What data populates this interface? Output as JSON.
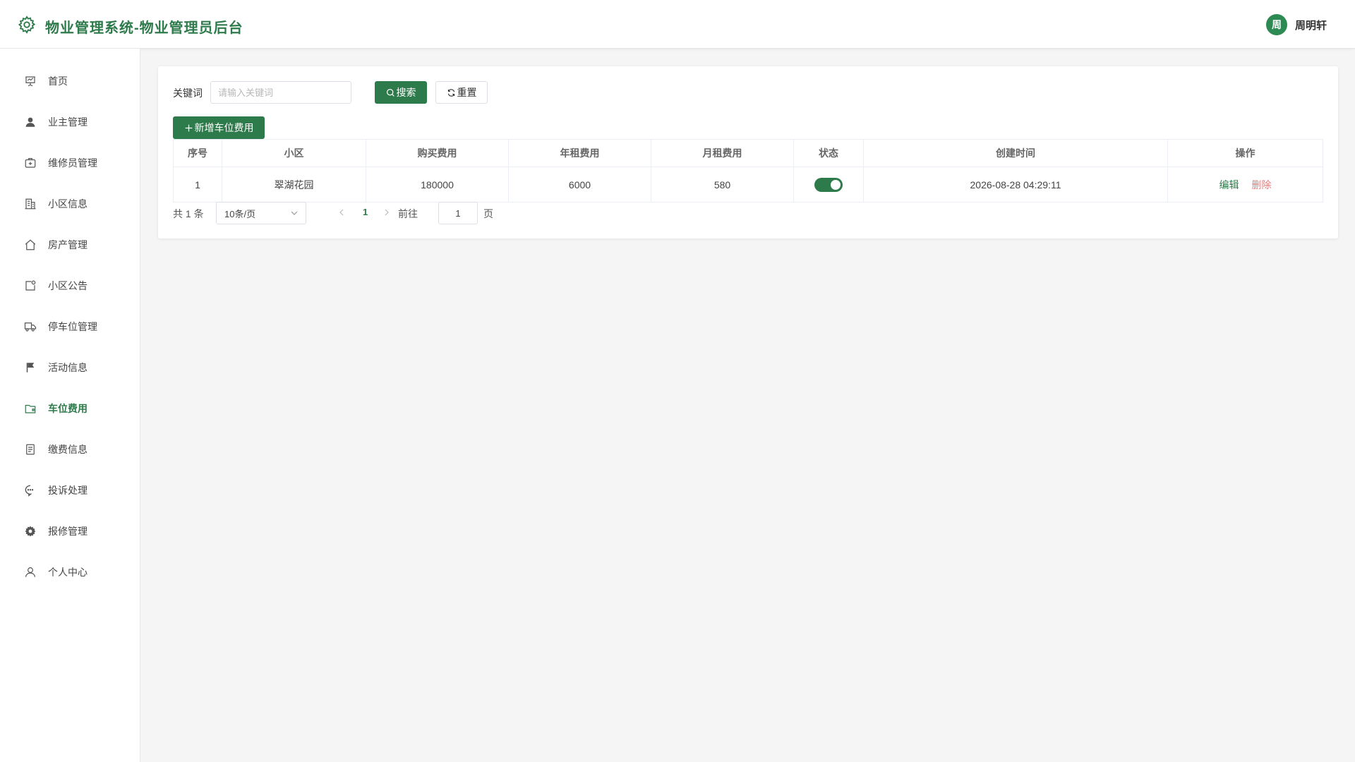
{
  "header": {
    "title": "物业管理系统-物业管理员后台",
    "user_avatar_text": "周",
    "user_name": "周明轩"
  },
  "sidebar": {
    "items": [
      {
        "label": "首页",
        "icon": "presentation-icon"
      },
      {
        "label": "业主管理",
        "icon": "user-icon"
      },
      {
        "label": "维修员管理",
        "icon": "first-aid-kit-icon"
      },
      {
        "label": "小区信息",
        "icon": "building-icon"
      },
      {
        "label": "房产管理",
        "icon": "house-icon"
      },
      {
        "label": "小区公告",
        "icon": "notice-icon"
      },
      {
        "label": "停车位管理",
        "icon": "truck-icon"
      },
      {
        "label": "活动信息",
        "icon": "flag-icon"
      },
      {
        "label": "车位费用",
        "icon": "wallet-icon",
        "active": true
      },
      {
        "label": "缴费信息",
        "icon": "document-icon"
      },
      {
        "label": "投诉处理",
        "icon": "chat-bubble-icon"
      },
      {
        "label": "报修管理",
        "icon": "gear-icon"
      },
      {
        "label": "个人中心",
        "icon": "user-outline-icon"
      }
    ]
  },
  "search": {
    "label": "关键词",
    "placeholder": "请输入关键词",
    "value": "",
    "search_button": "搜索",
    "reset_button": "重置",
    "add_button": "新增车位费用"
  },
  "table": {
    "headers": [
      "序号",
      "小区",
      "购买费用",
      "年租费用",
      "月租费用",
      "状态",
      "创建时间",
      "操作"
    ],
    "rows": [
      {
        "index": "1",
        "community": "翠湖花园",
        "purchase_fee": "180000",
        "annual_rent": "6000",
        "monthly_rent": "580",
        "status_on": true,
        "created_at": "2026-08-28 04:29:11",
        "edit_label": "编辑",
        "delete_label": "删除"
      }
    ]
  },
  "pagination": {
    "total_text": "共 1 条",
    "page_size": "10条/页",
    "current_page": "1",
    "goto_label": "前往",
    "goto_value": "1",
    "page_label": "页"
  },
  "colors": {
    "primary": "#2d7a4a",
    "danger": "#e87a7a",
    "background": "#f4f5f4"
  }
}
